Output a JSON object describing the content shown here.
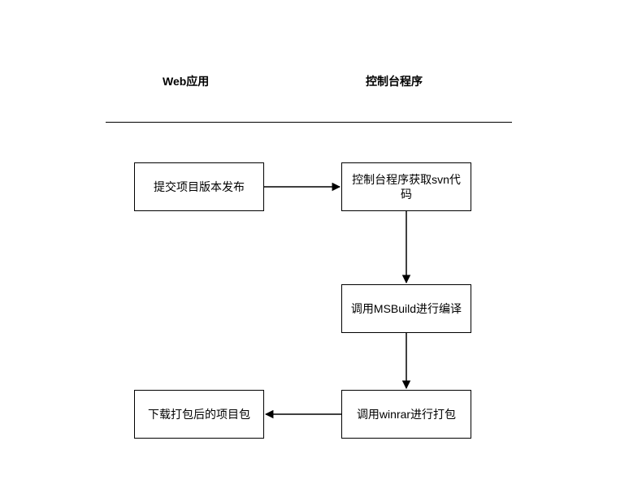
{
  "headers": {
    "left": "Web应用",
    "right": "控制台程序"
  },
  "nodes": {
    "submit": "提交项目版本发布",
    "svn": "控制台程序获取svn代码",
    "msbuild": "调用MSBuild进行编译",
    "winrar": "调用winrar进行打包",
    "download": "下载打包后的项目包"
  },
  "chart_data": {
    "type": "flowchart",
    "lanes": [
      {
        "name": "Web应用",
        "nodes": [
          "submit",
          "download"
        ]
      },
      {
        "name": "控制台程序",
        "nodes": [
          "svn",
          "msbuild",
          "winrar"
        ]
      }
    ],
    "nodes": [
      {
        "id": "submit",
        "label": "提交项目版本发布",
        "lane": "Web应用"
      },
      {
        "id": "svn",
        "label": "控制台程序获取svn代码",
        "lane": "控制台程序"
      },
      {
        "id": "msbuild",
        "label": "调用MSBuild进行编译",
        "lane": "控制台程序"
      },
      {
        "id": "winrar",
        "label": "调用winrar进行打包",
        "lane": "控制台程序"
      },
      {
        "id": "download",
        "label": "下载打包后的项目包",
        "lane": "Web应用"
      }
    ],
    "edges": [
      {
        "from": "submit",
        "to": "svn"
      },
      {
        "from": "svn",
        "to": "msbuild"
      },
      {
        "from": "msbuild",
        "to": "winrar"
      },
      {
        "from": "winrar",
        "to": "download"
      }
    ]
  }
}
